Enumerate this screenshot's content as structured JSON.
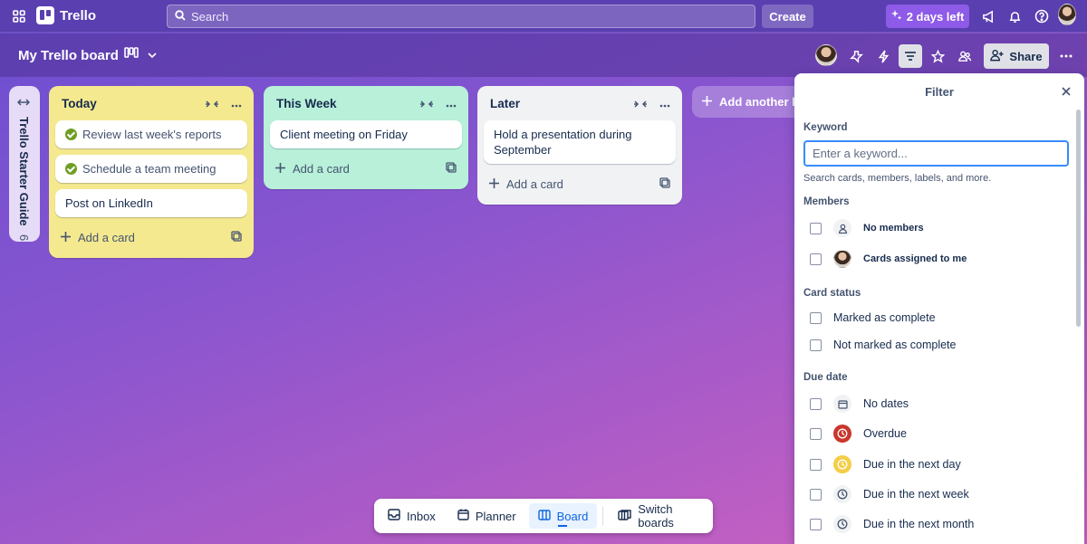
{
  "app": {
    "name": "Trello"
  },
  "topbar": {
    "search_placeholder": "Search",
    "create_label": "Create",
    "trial_label": "2 days left"
  },
  "board": {
    "title": "My Trello board",
    "share_label": "Share"
  },
  "collapsed_list": {
    "title": "Trello Starter Guide",
    "count": "6"
  },
  "lists": [
    {
      "title": "Today",
      "color": "#f5e98f",
      "cards": [
        {
          "text": "Review last week's reports",
          "done": true
        },
        {
          "text": "Schedule a team meeting",
          "done": true
        },
        {
          "text": "Post on LinkedIn",
          "done": false
        }
      ],
      "add_label": "Add a card"
    },
    {
      "title": "This Week",
      "color": "#b8f0d9",
      "cards": [
        {
          "text": "Client meeting on Friday",
          "done": false
        }
      ],
      "add_label": "Add a card"
    },
    {
      "title": "Later",
      "color": "#f1f2f4",
      "cards": [
        {
          "text": "Hold a presentation during September",
          "done": false
        }
      ],
      "add_label": "Add a card"
    }
  ],
  "add_list_label": "Add another list",
  "bottom_nav": {
    "inbox": "Inbox",
    "planner": "Planner",
    "board": "Board",
    "switch": "Switch boards"
  },
  "filter": {
    "title": "Filter",
    "keyword_heading": "Keyword",
    "keyword_placeholder": "Enter a keyword...",
    "keyword_help": "Search cards, members, labels, and more.",
    "members_heading": "Members",
    "members": [
      "No members",
      "Cards assigned to me"
    ],
    "status_heading": "Card status",
    "status": [
      "Marked as complete",
      "Not marked as complete"
    ],
    "due_heading": "Due date",
    "due": [
      "No dates",
      "Overdue",
      "Due in the next day",
      "Due in the next week",
      "Due in the next month"
    ]
  },
  "colors": {
    "overdue": "#c9372c",
    "due_soon": "#f5cd47",
    "accent": "#0c66e4"
  }
}
